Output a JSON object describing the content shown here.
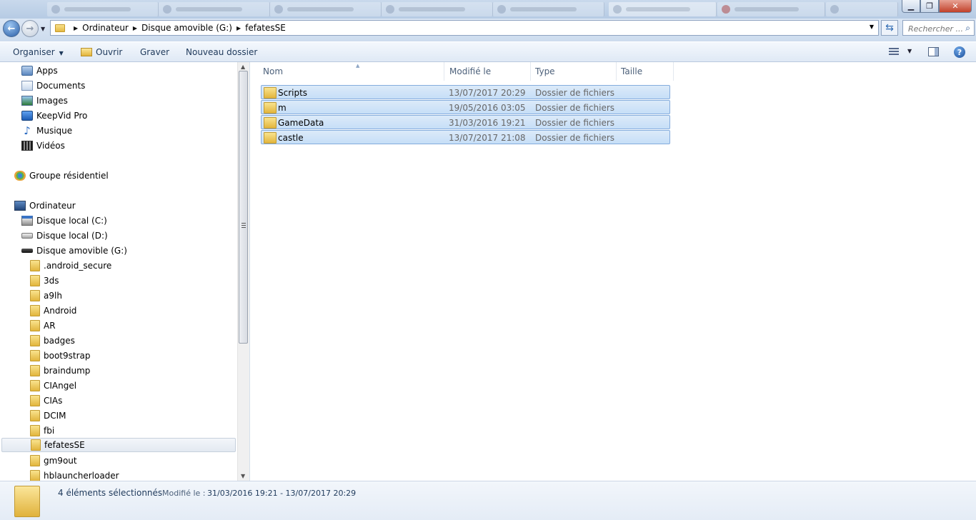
{
  "address": {
    "breadcrumbs": [
      "Ordinateur",
      "Disque amovible (G:)",
      "fefatesSE"
    ]
  },
  "search": {
    "placeholder": "Rechercher ..."
  },
  "toolbar": {
    "organize_label": "Organiser",
    "open_label": "Ouvrir",
    "burn_label": "Graver",
    "new_folder_label": "Nouveau dossier"
  },
  "nav": {
    "libraries": [
      {
        "label": "Apps",
        "icon": "apps-icon"
      },
      {
        "label": "Documents",
        "icon": "documents-icon"
      },
      {
        "label": "Images",
        "icon": "images-icon"
      },
      {
        "label": "KeepVid Pro",
        "icon": "keepvid-icon"
      },
      {
        "label": "Musique",
        "icon": "music-icon"
      },
      {
        "label": "Vidéos",
        "icon": "videos-icon"
      }
    ],
    "homegroup": "Groupe résidentiel",
    "computer": "Ordinateur",
    "drives": [
      "Disque local (C:)",
      "Disque local (D:)",
      "Disque amovible (G:)"
    ],
    "folders": [
      ".android_secure",
      "3ds",
      "a9lh",
      "Android",
      "AR",
      "badges",
      "boot9strap",
      "braindump",
      "CIAngel",
      "CIAs",
      "DCIM",
      "fbi",
      "fefatesSE",
      "gm9out",
      "hblauncherloader"
    ],
    "selected_folder": "fefatesSE"
  },
  "columns": {
    "name": "Nom",
    "modified": "Modifié le",
    "type": "Type",
    "size": "Taille"
  },
  "files": [
    {
      "name": "Scripts",
      "modified": "13/07/2017 20:29",
      "type": "Dossier de fichiers",
      "selected": true
    },
    {
      "name": "m",
      "modified": "19/05/2016 03:05",
      "type": "Dossier de fichiers",
      "selected": true
    },
    {
      "name": "GameData",
      "modified": "31/03/2016 19:21",
      "type": "Dossier de fichiers",
      "selected": true
    },
    {
      "name": "castle",
      "modified": "13/07/2017 21:08",
      "type": "Dossier de fichiers",
      "selected": true
    }
  ],
  "status": {
    "count": "4 éléments sélectionnés",
    "modified_label": "Modifié le :",
    "modified_value": "31/03/2016 19:21 - 13/07/2017 20:29"
  },
  "colors": {
    "selection_fill": "#cde3f8",
    "selection_border": "#84acdd",
    "toolbar_text": "#1e395b",
    "close_button": "#c2412a"
  }
}
